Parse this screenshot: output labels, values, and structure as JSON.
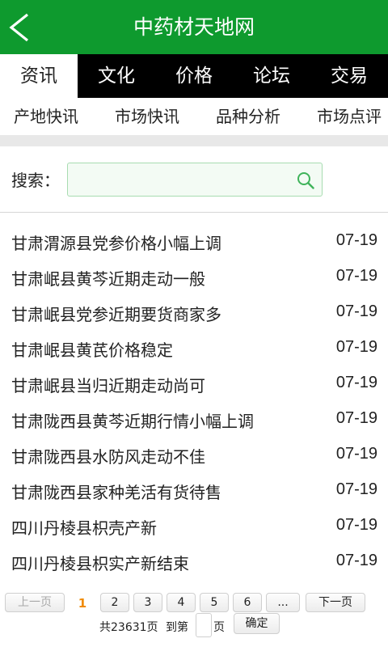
{
  "header": {
    "title": "中药材天地网",
    "back_icon": "back-chevron-icon"
  },
  "main_tabs": [
    {
      "label": "资讯",
      "active": true
    },
    {
      "label": "文化",
      "active": false
    },
    {
      "label": "价格",
      "active": false
    },
    {
      "label": "论坛",
      "active": false
    },
    {
      "label": "交易",
      "active": false
    }
  ],
  "sub_tabs": [
    {
      "label": "产地快讯"
    },
    {
      "label": "市场快讯"
    },
    {
      "label": "品种分析"
    },
    {
      "label": "市场点评"
    }
  ],
  "search": {
    "label": "搜索：",
    "value": "",
    "placeholder": "",
    "icon": "search-icon"
  },
  "news": [
    {
      "title": "甘肃渭源县党参价格小幅上调",
      "date": "07-19"
    },
    {
      "title": "甘肃岷县黄芩近期走动一般",
      "date": "07-19"
    },
    {
      "title": "甘肃岷县党参近期要货商家多",
      "date": "07-19"
    },
    {
      "title": "甘肃岷县黄芪价格稳定",
      "date": "07-19"
    },
    {
      "title": "甘肃岷县当归近期走动尚可",
      "date": "07-19"
    },
    {
      "title": "甘肃陇西县黄芩近期行情小幅上调",
      "date": "07-19"
    },
    {
      "title": "甘肃陇西县水防风走动不佳",
      "date": "07-19"
    },
    {
      "title": "甘肃陇西县家种羌活有货待售",
      "date": "07-19"
    },
    {
      "title": "四川丹棱县枳壳产新",
      "date": "07-19"
    },
    {
      "title": "四川丹棱县枳实产新结束",
      "date": "07-19"
    }
  ],
  "pagination": {
    "prev_label": "上一页",
    "current": "1",
    "pages": [
      "2",
      "3",
      "4",
      "5",
      "6"
    ],
    "ellipsis": "...",
    "next_label": "下一页",
    "total_text": "共23631页",
    "goto_prefix": "到第",
    "goto_suffix": "页",
    "goto_value": "",
    "confirm_label": "确定"
  },
  "colors": {
    "brand_green": "#0e9a2e",
    "tab_bar": "#000000",
    "current_page": "#f08a00",
    "search_border": "#a8dcb1",
    "search_icon": "#3fb35a"
  }
}
